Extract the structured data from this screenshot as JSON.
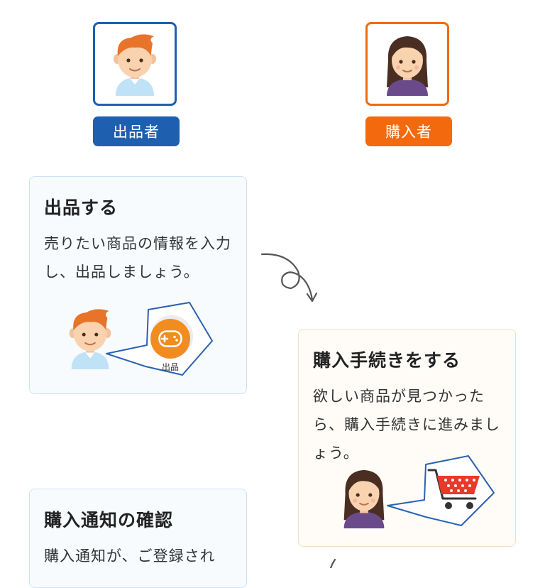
{
  "roles": {
    "seller": {
      "label": "出品者",
      "color": "#1f5fb0"
    },
    "buyer": {
      "label": "購入者",
      "color": "#f26a0d"
    }
  },
  "steps": [
    {
      "title": "出品する",
      "description": "売りたい商品の情報を入力し、出品しましょう。",
      "bubble_label": "出品"
    },
    {
      "title": "購入手続きをする",
      "description": "欲しい商品が見つかったら、購入手続きに進みましょう。"
    },
    {
      "title": "購入通知の確認",
      "description": "購入通知が、ご登録され"
    }
  ],
  "icons": {
    "seller_avatar": "boy-avatar-icon",
    "buyer_avatar": "girl-avatar-icon",
    "listing_button": "gamepad-icon",
    "purchase": "shopping-cart-icon",
    "flow": "curly-arrow-icon"
  }
}
